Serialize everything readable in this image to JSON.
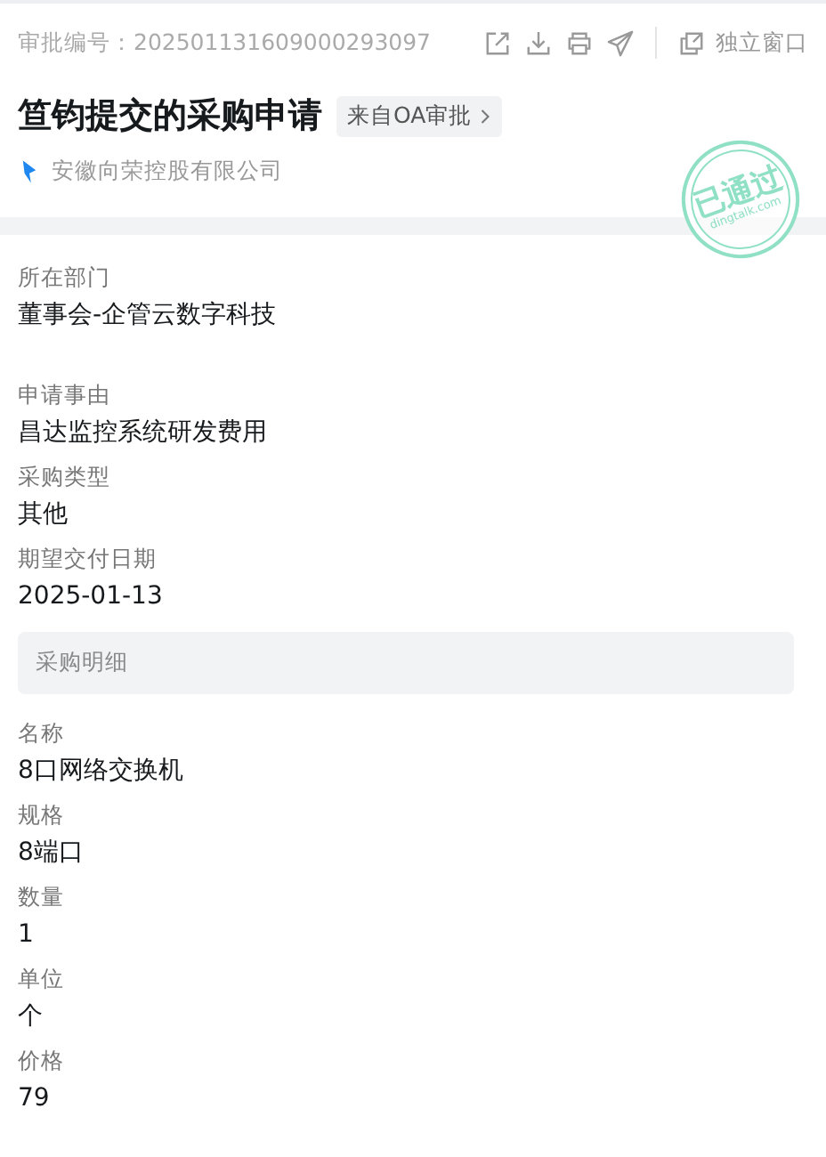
{
  "header": {
    "approval_no": "审批编号：202501131609000293097",
    "toolbar": [
      {
        "kind": "share"
      },
      {
        "kind": "download"
      },
      {
        "kind": "print"
      },
      {
        "kind": "send"
      }
    ],
    "window_button": "独立窗口"
  },
  "title": "笪钧提交的采购申请",
  "source_tag": "来自OA审批",
  "company": "安徽向荣控股有限公司",
  "stamp": {
    "text": "已通过",
    "domain": "dingtalk.com"
  },
  "groups": [
    [
      {
        "label": "所在部门",
        "value": "董事会-企管云数字科技"
      }
    ],
    [
      {
        "label": "申请事由",
        "value": "昌达监控系统研发费用"
      },
      {
        "label": "采购类型",
        "value": "其他"
      },
      {
        "label": "期望交付日期",
        "value": "2025-01-13"
      }
    ]
  ],
  "detail": {
    "title": "采购明细",
    "fields": [
      {
        "label": "名称",
        "value": "8口网络交换机"
      },
      {
        "label": "规格",
        "value": "8端口"
      },
      {
        "label": "数量",
        "value": "1"
      },
      {
        "label": "单位",
        "value": "个"
      },
      {
        "label": "价格",
        "value": "79"
      }
    ]
  }
}
